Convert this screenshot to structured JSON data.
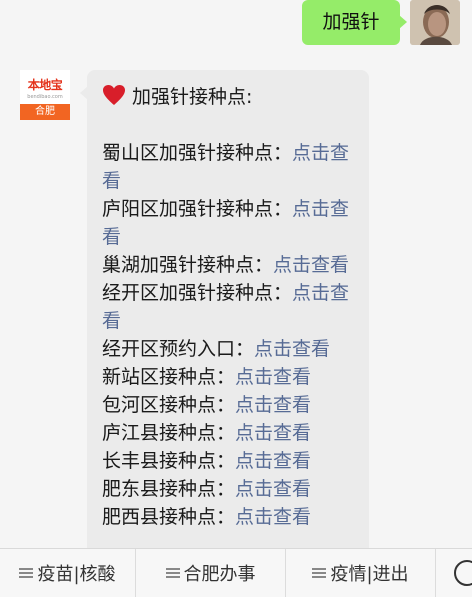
{
  "outgoing": {
    "text": "加强针"
  },
  "bot": {
    "logo_brand": "本地宝",
    "logo_domain": "bendibao.com",
    "logo_city": "合肥"
  },
  "message": {
    "heading": "加强针接种点:",
    "entries": [
      {
        "label": "蜀山区加强针接种点：",
        "link": "点击查看"
      },
      {
        "label": "庐阳区加强针接种点：",
        "link": "点击查看"
      },
      {
        "label": "巢湖加强针接种点：",
        "link": "点击查看"
      },
      {
        "label": "经开区加强针接种点：",
        "link": "点击查看"
      },
      {
        "label": "经开区预约入口：",
        "link": "点击查看"
      },
      {
        "label": "新站区接种点：",
        "link": "点击查看"
      },
      {
        "label": "包河区接种点：",
        "link": "点击查看"
      },
      {
        "label": "庐江县接种点：",
        "link": "点击查看"
      },
      {
        "label": "长丰县接种点：",
        "link": "点击查看"
      },
      {
        "label": "肥东县接种点：",
        "link": "点击查看"
      },
      {
        "label": "肥西县接种点：",
        "link": "点击查看"
      }
    ]
  },
  "menu": {
    "items": [
      "疫苗|核酸",
      "合肥办事",
      "疫情|进出"
    ],
    "keyboard_icon": "keyboard-icon"
  },
  "colors": {
    "outgoing_bubble": "#95ec69",
    "link": "#576b95",
    "logo_orange": "#f26522"
  }
}
